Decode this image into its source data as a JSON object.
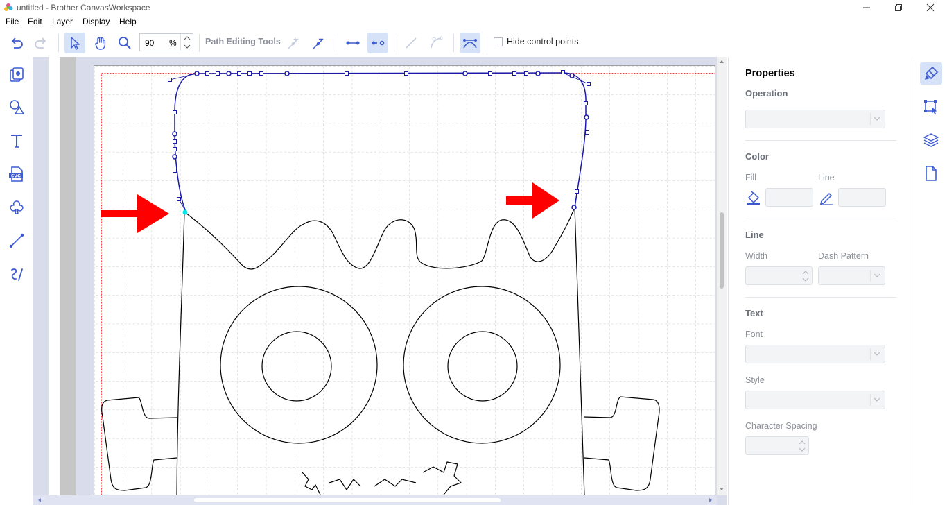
{
  "window": {
    "title": "untitled - Brother CanvasWorkspace"
  },
  "menu": {
    "items": [
      "File",
      "Edit",
      "Layer",
      "Display",
      "Help"
    ]
  },
  "toolbar": {
    "zoom_value": "90",
    "zoom_unit": "%",
    "path_editing_label": "Path Editing Tools",
    "hide_control_points_label": "Hide control points",
    "hide_control_points_checked": false
  },
  "properties": {
    "title": "Properties",
    "operation_label": "Operation",
    "color_label": "Color",
    "fill_label": "Fill",
    "line_color_label": "Line",
    "line_section_label": "Line",
    "width_label": "Width",
    "dash_pattern_label": "Dash Pattern",
    "text_section_label": "Text",
    "font_label": "Font",
    "style_label": "Style",
    "char_spacing_label": "Character Spacing"
  },
  "colors": {
    "accent": "#3d5bd0",
    "path_selected": "#1a1aa8",
    "arrow_red": "#ff0000",
    "node_highlight": "#00e5e5",
    "active_button_bg": "#d6e2f7"
  },
  "icons": {
    "left_tools": [
      "project-icon",
      "shapes-icon",
      "text-icon",
      "svg-import-icon",
      "pattern-icon",
      "line-icon",
      "freehand-icon"
    ],
    "right_tabs": [
      "properties-brush-icon",
      "select-transform-icon",
      "layers-icon",
      "page-icon"
    ]
  }
}
